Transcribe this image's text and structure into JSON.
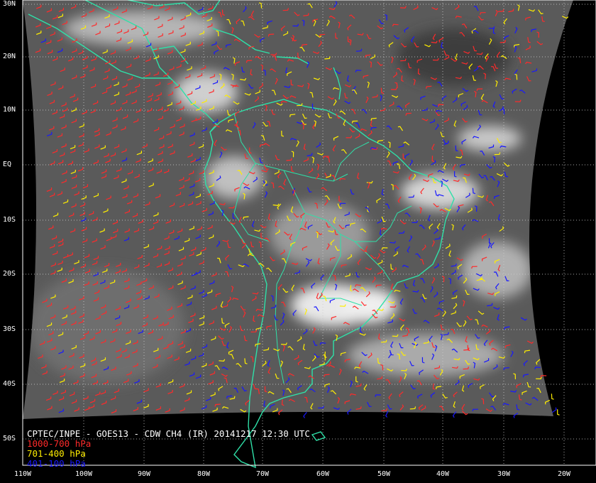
{
  "map": {
    "caption": {
      "title": "CPTEC/INPE - GOES13 - CDW CH4 (IR) 20141217 12:30 UTC",
      "legend": [
        {
          "label": "1000-700 hPa",
          "color": "#ff2a2a"
        },
        {
          "label": "701-400 hPa",
          "color": "#ffee00"
        },
        {
          "label": "401-100 hPa",
          "color": "#1818ff"
        }
      ]
    },
    "lat_labels": [
      "30N",
      "20N",
      "10N",
      "EQ",
      "10S",
      "20S",
      "30S",
      "40S",
      "50S"
    ],
    "lon_labels": [
      "110W",
      "100W",
      "90W",
      "80W",
      "70W",
      "60W",
      "50W",
      "40W",
      "30W",
      "20W"
    ],
    "colors": {
      "background": "#000000",
      "coastline": "#2fe0a8",
      "grid": "#cccccc",
      "frame": "#ffffff"
    }
  }
}
